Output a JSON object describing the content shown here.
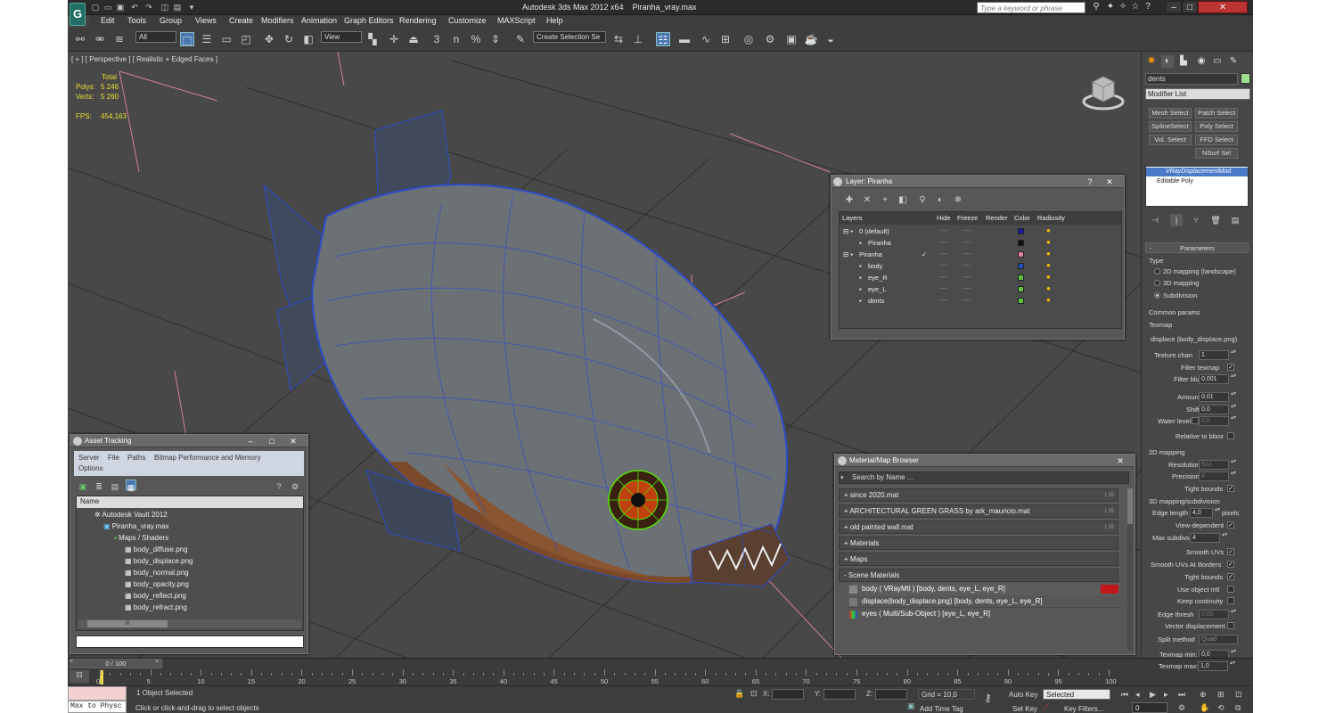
{
  "app": {
    "title": "Autodesk 3ds Max  2012 x64",
    "file": "Piranha_vray.max",
    "logo": "G",
    "search_placeholder": "Type a keyword or phrase"
  },
  "menus": [
    "Edit",
    "Tools",
    "Group",
    "Views",
    "Create",
    "Modifiers",
    "Animation",
    "Graph Editors",
    "Rendering",
    "Customize",
    "MAXScript",
    "Help"
  ],
  "toolbar": {
    "filter_value": "All",
    "refcoord_value": "View",
    "selection_set_value": "Create Selection Se",
    "snap_3": "3",
    "angle_snap": "n",
    "percent_snap": "%"
  },
  "viewport": {
    "label": "[ + ] [ Perspective ] [ Realistic + Edged Faces ]",
    "stats_total": "Total",
    "stats_polys_label": "Polys:",
    "stats_polys": "5 246",
    "stats_verts_label": "Verts:",
    "stats_verts": "5 260",
    "stats_fps_label": "FPS:",
    "stats_fps": "454,163"
  },
  "asset_tracking": {
    "title": "Asset Tracking",
    "menu": [
      "Server",
      "File",
      "Paths",
      "Bitmap Performance and Memory",
      "Options"
    ],
    "column": "Name",
    "rows": [
      "Autodesk Vault 2012",
      "Piranha_vray.max",
      "Maps / Shaders",
      "body_diffuse.png",
      "body_displace.png",
      "body_normal.png",
      "body_opacity.png",
      "body_reflect.png",
      "body_refract.png"
    ],
    "scroll_thumb": "III"
  },
  "layer_panel": {
    "title": "Layer: Piranha",
    "columns": [
      "Layers",
      "Hide",
      "Freeze",
      "Render",
      "Color",
      "Radiosity"
    ],
    "rows": [
      {
        "name": "0 (default)",
        "color": "#1a1aa0"
      },
      {
        "name": "Piranha",
        "color": "#111111"
      },
      {
        "name": "Piranha",
        "color": "#e080a0"
      },
      {
        "name": "body",
        "color": "#2050c0"
      },
      {
        "name": "eye_R",
        "color": "#60c040"
      },
      {
        "name": "eye_L",
        "color": "#60c040"
      },
      {
        "name": "dents",
        "color": "#60c040"
      }
    ],
    "dash": "----",
    "check": "✓"
  },
  "material_browser": {
    "title": "Material/Map Browser",
    "search_placeholder": "Search by Name ...",
    "groups": [
      "since 2020.mat",
      "ARCHITECTURAL GREEN GRASS by ark_mauricio.mat",
      "old painted wall.mat",
      "Materials",
      "Maps",
      "Scene Materials"
    ],
    "lib_tag": "LIB",
    "scene_items": [
      "body  ( VRayMtl ) [body, dents, eye_L, eye_R]",
      "displace(body_displace.png) [body, dents, eye_L, eye_R]",
      "eyes  ( Multi/Sub-Object ) [eye_L, eye_R]"
    ]
  },
  "command_panel": {
    "object_name": "dents",
    "modifier_list": "Modifier List",
    "buttons": [
      "Mesh Select",
      "Patch Select",
      "SplineSelect",
      "Poly Select",
      "Vol. Select",
      "FFD Select",
      "NSurf Sel"
    ],
    "stack": [
      "VRayDisplacementMod",
      "Editable Poly"
    ],
    "params_title": "Parameters",
    "type_label": "Type",
    "type_options": [
      "2D mapping (landscape)",
      "3D mapping",
      "Subdivision"
    ],
    "common_params": "Common params",
    "texmap_label": "Texmap",
    "texmap_value": "displace (body_displace.png)",
    "texture_chan_label": "Texture chan",
    "texture_chan": "1",
    "filter_texmap": "Filter texmap",
    "filter_blur_label": "Filter blur",
    "filter_blur": "0,001",
    "amount_label": "Amount",
    "amount": "0,01",
    "shift_label": "Shift",
    "shift": "0,0",
    "water_level_label": "Water level",
    "water_level": "0,0",
    "relative_bbox": "Relative to bbox",
    "mapping2d": "2D mapping",
    "resolution_label": "Resolution",
    "resolution": "512",
    "precision_label": "Precision",
    "precision": "8",
    "tight_bounds": "Tight bounds",
    "mapping3d": "3D mapping/subdivision",
    "edge_length_label": "Edge length",
    "edge_length": "4,0",
    "pixels": "pixels",
    "view_dependent": "View-dependent",
    "max_subdivs_label": "Max subdivs",
    "max_subdivs": "4",
    "smooth_uvs": "Smooth UVs",
    "smooth_uvs_borders": "Smooth UVs At Borders",
    "tight_bounds2": "Tight bounds",
    "use_object_mtl": "Use object mtl",
    "keep_continuity": "Keep continuity",
    "edge_thresh_label": "Edge thresh",
    "edge_thresh": "0,05",
    "vector_displacement": "Vector displacement",
    "split_method_label": "Split method",
    "split_method": "Quad",
    "texmap_min_label": "Texmap min:",
    "texmap_min": "0,0",
    "texmap_max_label": "Texmap max:",
    "texmap_max": "1,0"
  },
  "timeline": {
    "frame": "0 / 100",
    "ticks": [
      "0",
      "5",
      "10",
      "15",
      "20",
      "25",
      "30",
      "35",
      "40",
      "45",
      "50",
      "55",
      "60",
      "65",
      "70",
      "75",
      "80",
      "85",
      "90",
      "95",
      "100"
    ]
  },
  "status": {
    "maxscript": "Max to Physc",
    "selected": "1 Object Selected",
    "prompt": "Click or click-and-drag to select objects",
    "x_label": "X:",
    "y_label": "Y:",
    "z_label": "Z:",
    "grid": "Grid = 10,0",
    "add_time_tag": "Add Time Tag",
    "auto_key": "Auto Key",
    "set_key": "Set Key",
    "key_mode": "Selected",
    "key_filters": "Key Filters...",
    "frame_field": "0"
  },
  "colors": {
    "active_blue": "#4a77b0",
    "fish_body": "#6c7176",
    "wire": "#2e4cc8",
    "eye_green": "#55e000"
  }
}
